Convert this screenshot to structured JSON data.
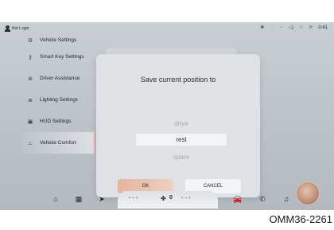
{
  "status": {
    "login": "Not Login",
    "icons": [
      "bluetooth-icon",
      "signal-icon",
      "wifi-icon",
      "volume-icon",
      "mute-icon",
      "sync-icon"
    ],
    "time": "0:41"
  },
  "sidebar": {
    "items": [
      {
        "label": "Vehicle Settings",
        "icon": "car-settings-icon"
      },
      {
        "label": "Smart Key Settings",
        "icon": "key-icon"
      },
      {
        "label": "Driver Assistance",
        "icon": "steering-icon"
      },
      {
        "label": "Lighting Settings",
        "icon": "headlight-icon"
      },
      {
        "label": "HUD Settings",
        "icon": "hud-icon"
      },
      {
        "label": "Vehicle Comfort",
        "icon": "seat-icon",
        "active": true
      }
    ]
  },
  "dialog": {
    "title": "Save current position to",
    "options": [
      {
        "label": "drive",
        "selected": false
      },
      {
        "label": "rest",
        "selected": true
      },
      {
        "label": "spare",
        "selected": false
      }
    ],
    "ok_label": "OK",
    "cancel_label": "CANCEL"
  },
  "dock": {
    "left_temp": "‹  --  ›",
    "fan_value": "0",
    "right_temp": "‹  --  ›",
    "icons": [
      "home-icon",
      "apps-icon",
      "navigation-icon",
      "car-icon",
      "phone-icon",
      "music-icon"
    ]
  },
  "doc_code": "OMM36-2261",
  "colors": {
    "accent": "#e6b59a",
    "ok_button": "#e4b49e"
  }
}
